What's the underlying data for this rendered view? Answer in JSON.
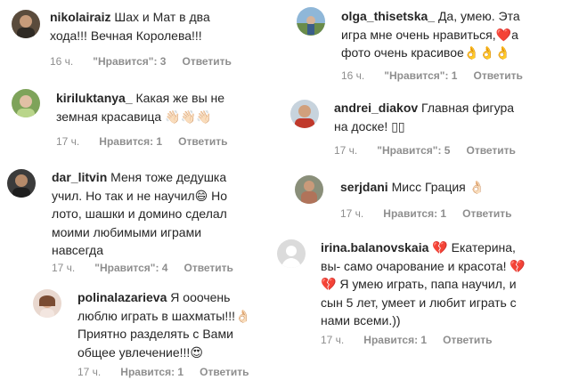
{
  "comments": [
    {
      "user": "nikolairaiz",
      "text": "Шах и Мат в два хода!!! Вечная Королева!!!",
      "time": "16 ч.",
      "likes": "\"Нравится\": 3",
      "reply": "Ответить"
    },
    {
      "user": "kiriluktanya_",
      "text": "Какая же вы не земная красавица 👋🏻👋🏻👋🏻",
      "time": "17 ч.",
      "likes": "Нравится: 1",
      "reply": "Ответить"
    },
    {
      "user": "dar_litvin",
      "text": "Меня тоже дедушка учил. Но так и не научил😄 Но лото, шашки и домино сделал моими любимыми играми навсегда",
      "time": "17 ч.",
      "likes": "\"Нравится\": 4",
      "reply": "Ответить"
    },
    {
      "user": "polinalazarieva",
      "text": "Я ооочень люблю играть в шахматы!!!👌🏻 Приятно разделять с Вами общее увлечение!!!😍",
      "time": "17 ч.",
      "likes": "Нравится: 1",
      "reply": "Ответить"
    },
    {
      "user": "olga_thisetska_",
      "text": "Да, умею. Эта игра мне очень нравиться,❤️а фото очень красивое👌👌👌",
      "time": "16 ч.",
      "likes": "\"Нравится\": 1",
      "reply": "Ответить"
    },
    {
      "user": "andrei_diakov",
      "text": "Главная фигура на доске! ▯▯",
      "time": "17 ч.",
      "likes": "\"Нравится\": 5",
      "reply": "Ответить"
    },
    {
      "user": "serjdani",
      "text": "Мисс Грация 👌🏻",
      "time": "17 ч.",
      "likes": "Нравится: 1",
      "reply": "Ответить"
    },
    {
      "user": "irina.balanovskaia",
      "text": "💔 Екатерина, вы- само очарование и красота! 💔💔 Я умею играть, папа научил, и сын 5 лет, умеет и любит играть с нами всеми.))",
      "time": "17 ч.",
      "likes": "Нравится: 1",
      "reply": "Ответить"
    }
  ],
  "colors": {
    "username": "#262626",
    "text": "#262626",
    "meta": "#8e8e8e",
    "background": "#ffffff"
  }
}
